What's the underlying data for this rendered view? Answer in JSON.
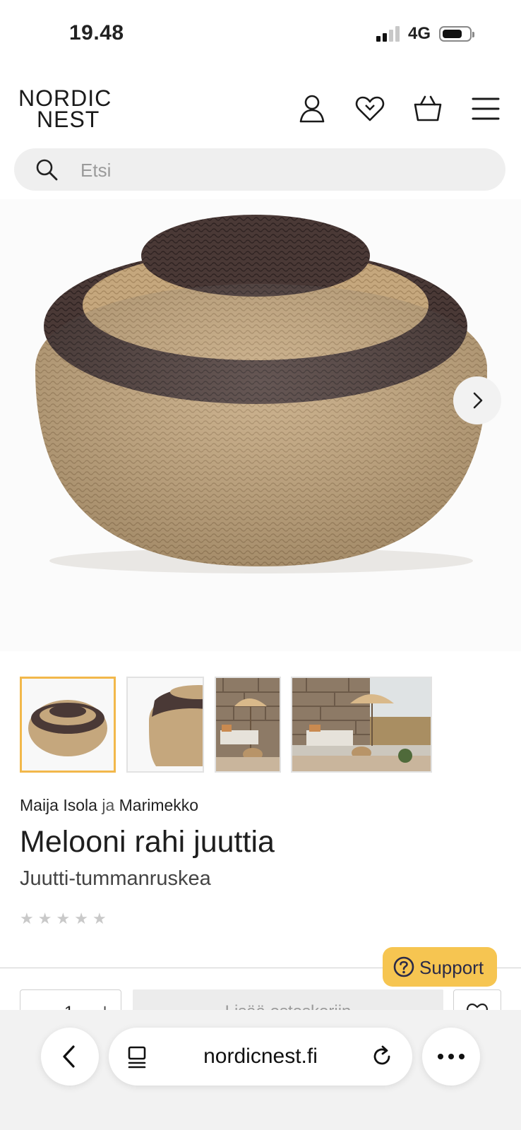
{
  "status_bar": {
    "time": "19.48",
    "network": "4G",
    "signal_bars": 2,
    "signal_bars_max": 4,
    "battery_level": 0.75
  },
  "header": {
    "logo_line1": "NORDIC",
    "logo_line2": "NEST",
    "icons": [
      "account-icon",
      "heart-icon",
      "cart-icon",
      "menu-icon"
    ]
  },
  "search": {
    "placeholder": "Etsi",
    "value": ""
  },
  "gallery": {
    "image_count": 4,
    "selected_index": 0
  },
  "product": {
    "designer": "Maija Isola",
    "conjunction": "ja",
    "brand": "Marimekko",
    "title": "Melooni rahi juuttia",
    "variant": "Juutti-tummanruskea",
    "rating_stars": 5,
    "rating_value": 0
  },
  "support": {
    "label": "Support"
  },
  "purchase": {
    "quantity": "1",
    "minus": "–",
    "plus": "+",
    "add_to_cart": "Lisää ostoskoriin"
  },
  "browser": {
    "url": "nordicnest.fi"
  },
  "colors": {
    "accent": "#f2b84b",
    "support": "#f6c551",
    "jute": "#c8aa80",
    "dark_band": "#4a3936"
  }
}
